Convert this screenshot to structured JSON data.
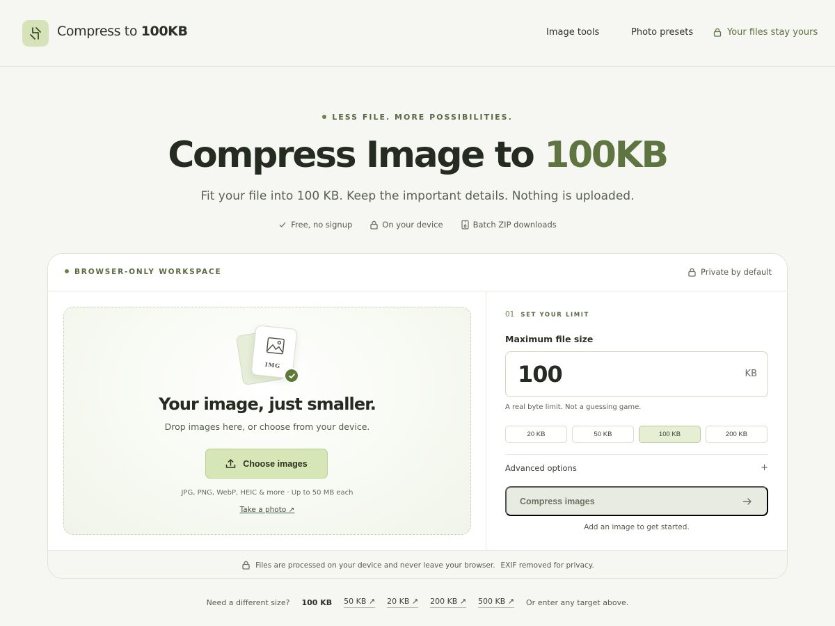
{
  "header": {
    "brand_prefix": "Compress to ",
    "brand_highlight": "100KB",
    "nav": [
      "Image tools",
      "Photo presets"
    ],
    "privacy_link": "Your files stay yours"
  },
  "hero": {
    "eyebrow": "LESS FILE. MORE POSSIBILITIES.",
    "title_prefix": "Compress Image to ",
    "title_accent": "100KB",
    "subtitle": "Fit your file into 100 KB. Keep the important details. Nothing is uploaded.",
    "badges": [
      "Free, no signup",
      "On your device",
      "Batch ZIP downloads"
    ]
  },
  "workspace": {
    "label": "BROWSER-ONLY WORKSPACE",
    "private_label": "Private by default",
    "dropzone": {
      "thumb_label": "IMG",
      "title": "Your image, just smaller.",
      "subtitle": "Drop images here, or choose from your device.",
      "choose_button": "Choose images",
      "formats": "JPG, PNG, WebP, HEIC & more · Up to 50 MB each",
      "take_photo": "Take a photo ↗"
    },
    "settings": {
      "step_number": "01",
      "step_label": "SET YOUR LIMIT",
      "field_label": "Maximum file size",
      "size_value": "100",
      "size_unit": "KB",
      "hint": "A real byte limit. Not a guessing game.",
      "presets": [
        "20 KB",
        "50 KB",
        "100 KB",
        "200 KB"
      ],
      "active_preset": "100 KB",
      "advanced_label": "Advanced options",
      "advanced_toggle": "+",
      "compress_button": "Compress images",
      "get_started": "Add an image to get started."
    },
    "footer_note": "Files are processed on your device and never leave your browser.",
    "footer_exif": "EXIF removed for privacy."
  },
  "other_sizes": {
    "prompt": "Need a different size?",
    "current": "100 KB",
    "links": [
      "50 KB ↗",
      "20 KB ↗",
      "200 KB ↗",
      "500 KB ↗"
    ],
    "tail": "Or enter any target above."
  },
  "colors": {
    "background": "#f6f7f2",
    "accent": "#5e7541",
    "button_fill": "#d7e6b6",
    "text": "#262b22"
  },
  "icons": [
    "logo-icon",
    "lock-icon",
    "check-icon",
    "file-zip-icon",
    "image-icon",
    "upload-icon",
    "arrow-right-icon"
  ]
}
